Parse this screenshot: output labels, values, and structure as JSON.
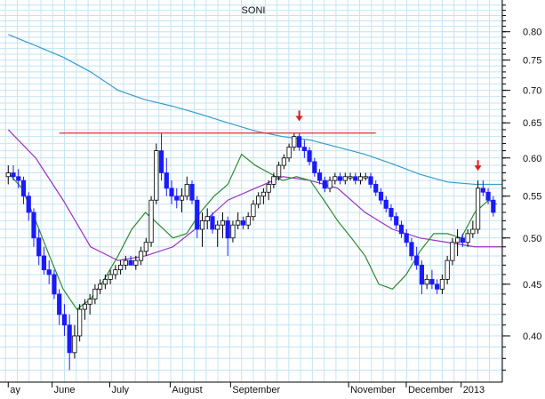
{
  "chart_data": {
    "type": "candlestick",
    "title": "SONI",
    "y_scale": "log",
    "ylim": [
      0.36,
      0.86
    ],
    "y_ticks": [
      "0.80",
      "0.75",
      "0.70",
      "0.65",
      "0.60",
      "0.55",
      "0.50",
      "0.45",
      "0.40"
    ],
    "x_ticks": [
      {
        "label": "ay",
        "day": 0
      },
      {
        "label": "June",
        "day": 16
      },
      {
        "label": "July",
        "day": 37
      },
      {
        "label": "August",
        "day": 59
      },
      {
        "label": "September",
        "day": 81
      },
      {
        "label": "November",
        "day": 124
      },
      {
        "label": "December",
        "day": 145
      },
      {
        "label": "2013",
        "day": 165
      }
    ],
    "grid": true,
    "colors": {
      "grid": "#c4e4f2",
      "up_bar": "#000000",
      "down_bar": "#1a1aff",
      "ma_short": "#2e8b2e",
      "ma_mid": "#9b30c0",
      "ma_long": "#3a9ad0",
      "resistance": "#e03030",
      "arrow": "#e02020"
    },
    "series": [
      {
        "x": [
          0,
          10,
          20,
          30,
          40,
          50,
          60,
          70,
          80,
          90,
          100,
          110,
          120,
          130,
          140,
          150,
          160,
          170,
          180
        ],
        "y": [
          0.795,
          0.775,
          0.755,
          0.73,
          0.7,
          0.685,
          0.675,
          0.663,
          0.65,
          0.638,
          0.63,
          0.625,
          0.615,
          0.605,
          0.592,
          0.578,
          0.568,
          0.565,
          0.565
        ]
      },
      {
        "x": [
          0,
          10,
          20,
          30,
          40,
          50,
          60,
          70,
          80,
          90,
          100,
          110,
          120,
          130,
          140,
          150,
          160,
          170,
          180
        ],
        "y": [
          0.64,
          0.6,
          0.545,
          0.49,
          0.475,
          0.48,
          0.49,
          0.515,
          0.545,
          0.56,
          0.575,
          0.57,
          0.56,
          0.53,
          0.51,
          0.5,
          0.495,
          0.49,
          0.49
        ]
      },
      {
        "x": [
          0,
          5,
          10,
          15,
          20,
          25,
          30,
          35,
          40,
          45,
          50,
          55,
          60,
          65,
          70,
          75,
          80,
          85,
          90,
          95,
          100,
          105,
          110,
          115,
          120,
          125,
          130,
          135,
          140,
          145,
          150,
          155,
          160,
          165,
          170,
          175,
          178
        ],
        "y": [
          0.58,
          0.56,
          0.52,
          0.48,
          0.445,
          0.425,
          0.435,
          0.455,
          0.48,
          0.51,
          0.53,
          0.515,
          0.5,
          0.505,
          0.53,
          0.55,
          0.565,
          0.605,
          0.59,
          0.58,
          0.57,
          0.575,
          0.57,
          0.545,
          0.52,
          0.5,
          0.48,
          0.45,
          0.445,
          0.46,
          0.485,
          0.505,
          0.505,
          0.5,
          0.53,
          0.545,
          0.54
        ]
      }
    ],
    "bars": [
      [
        0,
        0.575,
        0.59,
        0.565,
        0.58
      ],
      [
        1,
        0.58,
        0.59,
        0.57,
        0.575
      ],
      [
        2,
        0.575,
        0.585,
        0.56,
        0.57
      ],
      [
        3,
        0.57,
        0.575,
        0.54,
        0.55
      ],
      [
        4,
        0.55,
        0.555,
        0.52,
        0.53
      ],
      [
        5,
        0.53,
        0.535,
        0.49,
        0.5
      ],
      [
        6,
        0.5,
        0.51,
        0.47,
        0.48
      ],
      [
        7,
        0.48,
        0.49,
        0.46,
        0.465
      ],
      [
        8,
        0.465,
        0.475,
        0.45,
        0.46
      ],
      [
        9,
        0.46,
        0.465,
        0.435,
        0.44
      ],
      [
        10,
        0.44,
        0.445,
        0.41,
        0.42
      ],
      [
        11,
        0.42,
        0.43,
        0.4,
        0.41
      ],
      [
        12,
        0.41,
        0.42,
        0.37,
        0.385
      ],
      [
        13,
        0.385,
        0.41,
        0.38,
        0.4
      ],
      [
        14,
        0.4,
        0.43,
        0.395,
        0.425
      ],
      [
        15,
        0.425,
        0.435,
        0.415,
        0.43
      ],
      [
        16,
        0.43,
        0.44,
        0.42,
        0.435
      ],
      [
        17,
        0.435,
        0.45,
        0.43,
        0.445
      ],
      [
        18,
        0.445,
        0.455,
        0.44,
        0.45
      ],
      [
        19,
        0.45,
        0.46,
        0.445,
        0.455
      ],
      [
        20,
        0.455,
        0.465,
        0.45,
        0.46
      ],
      [
        21,
        0.46,
        0.47,
        0.455,
        0.465
      ],
      [
        22,
        0.465,
        0.475,
        0.46,
        0.47
      ],
      [
        23,
        0.47,
        0.48,
        0.465,
        0.475
      ],
      [
        24,
        0.475,
        0.48,
        0.47,
        0.47
      ],
      [
        25,
        0.47,
        0.48,
        0.465,
        0.475
      ],
      [
        26,
        0.475,
        0.49,
        0.47,
        0.485
      ],
      [
        27,
        0.485,
        0.5,
        0.48,
        0.495
      ],
      [
        28,
        0.495,
        0.55,
        0.49,
        0.545
      ],
      [
        29,
        0.545,
        0.62,
        0.54,
        0.61
      ],
      [
        30,
        0.61,
        0.635,
        0.57,
        0.58
      ],
      [
        31,
        0.58,
        0.6,
        0.55,
        0.56
      ],
      [
        32,
        0.56,
        0.57,
        0.54,
        0.55
      ],
      [
        33,
        0.55,
        0.56,
        0.535,
        0.545
      ],
      [
        34,
        0.545,
        0.56,
        0.53,
        0.55
      ],
      [
        35,
        0.55,
        0.575,
        0.545,
        0.565
      ],
      [
        36,
        0.565,
        0.57,
        0.54,
        0.545
      ],
      [
        37,
        0.545,
        0.55,
        0.5,
        0.51
      ],
      [
        38,
        0.51,
        0.53,
        0.49,
        0.52
      ],
      [
        39,
        0.52,
        0.535,
        0.51,
        0.525
      ],
      [
        40,
        0.525,
        0.53,
        0.505,
        0.51
      ],
      [
        41,
        0.51,
        0.52,
        0.49,
        0.515
      ],
      [
        42,
        0.515,
        0.53,
        0.5,
        0.52
      ],
      [
        43,
        0.52,
        0.525,
        0.48,
        0.5
      ],
      [
        44,
        0.5,
        0.52,
        0.495,
        0.515
      ],
      [
        45,
        0.515,
        0.53,
        0.51,
        0.52
      ],
      [
        46,
        0.52,
        0.525,
        0.51,
        0.515
      ],
      [
        47,
        0.515,
        0.53,
        0.51,
        0.525
      ],
      [
        48,
        0.525,
        0.545,
        0.52,
        0.54
      ],
      [
        49,
        0.54,
        0.555,
        0.535,
        0.55
      ],
      [
        50,
        0.55,
        0.56,
        0.54,
        0.555
      ],
      [
        51,
        0.555,
        0.57,
        0.545,
        0.565
      ],
      [
        52,
        0.565,
        0.58,
        0.56,
        0.575
      ],
      [
        53,
        0.575,
        0.595,
        0.57,
        0.59
      ],
      [
        54,
        0.59,
        0.605,
        0.585,
        0.6
      ],
      [
        55,
        0.6,
        0.62,
        0.595,
        0.615
      ],
      [
        56,
        0.615,
        0.635,
        0.61,
        0.63
      ],
      [
        57,
        0.63,
        0.635,
        0.61,
        0.615
      ],
      [
        58,
        0.615,
        0.625,
        0.6,
        0.61
      ],
      [
        59,
        0.61,
        0.615,
        0.59,
        0.595
      ],
      [
        60,
        0.595,
        0.6,
        0.575,
        0.58
      ],
      [
        61,
        0.58,
        0.585,
        0.565,
        0.57
      ],
      [
        62,
        0.57,
        0.575,
        0.555,
        0.56
      ],
      [
        63,
        0.56,
        0.575,
        0.555,
        0.57
      ],
      [
        64,
        0.57,
        0.58,
        0.565,
        0.575
      ],
      [
        65,
        0.575,
        0.58,
        0.565,
        0.57
      ],
      [
        66,
        0.57,
        0.58,
        0.565,
        0.575
      ],
      [
        67,
        0.575,
        0.58,
        0.57,
        0.575
      ],
      [
        68,
        0.575,
        0.58,
        0.565,
        0.57
      ],
      [
        69,
        0.57,
        0.58,
        0.565,
        0.575
      ],
      [
        70,
        0.575,
        0.58,
        0.57,
        0.575
      ],
      [
        71,
        0.575,
        0.58,
        0.56,
        0.565
      ],
      [
        72,
        0.565,
        0.57,
        0.55,
        0.555
      ],
      [
        73,
        0.555,
        0.56,
        0.54,
        0.545
      ],
      [
        74,
        0.545,
        0.55,
        0.53,
        0.535
      ],
      [
        75,
        0.535,
        0.54,
        0.52,
        0.525
      ],
      [
        76,
        0.525,
        0.53,
        0.51,
        0.515
      ],
      [
        77,
        0.515,
        0.52,
        0.5,
        0.505
      ],
      [
        78,
        0.505,
        0.51,
        0.49,
        0.495
      ],
      [
        79,
        0.495,
        0.5,
        0.475,
        0.48
      ],
      [
        80,
        0.48,
        0.49,
        0.465,
        0.47
      ],
      [
        81,
        0.47,
        0.475,
        0.44,
        0.45
      ],
      [
        82,
        0.45,
        0.46,
        0.445,
        0.455
      ],
      [
        83,
        0.455,
        0.465,
        0.445,
        0.45
      ],
      [
        84,
        0.45,
        0.455,
        0.44,
        0.445
      ],
      [
        85,
        0.445,
        0.46,
        0.44,
        0.455
      ],
      [
        86,
        0.455,
        0.48,
        0.45,
        0.475
      ],
      [
        87,
        0.475,
        0.5,
        0.47,
        0.495
      ],
      [
        88,
        0.495,
        0.51,
        0.48,
        0.5
      ],
      [
        89,
        0.5,
        0.505,
        0.49,
        0.495
      ],
      [
        90,
        0.495,
        0.51,
        0.49,
        0.505
      ],
      [
        91,
        0.505,
        0.52,
        0.5,
        0.51
      ],
      [
        92,
        0.51,
        0.57,
        0.505,
        0.56
      ],
      [
        93,
        0.56,
        0.57,
        0.55,
        0.555
      ],
      [
        94,
        0.555,
        0.56,
        0.54,
        0.545
      ],
      [
        95,
        0.545,
        0.55,
        0.525,
        0.53
      ]
    ],
    "annotations": [
      {
        "type": "horizontal-line",
        "y": 0.635,
        "x0": 10,
        "x1": 72
      },
      {
        "type": "arrow-down",
        "x": 57,
        "y": 0.655
      },
      {
        "type": "arrow-down",
        "x": 92,
        "y": 0.585
      }
    ]
  }
}
